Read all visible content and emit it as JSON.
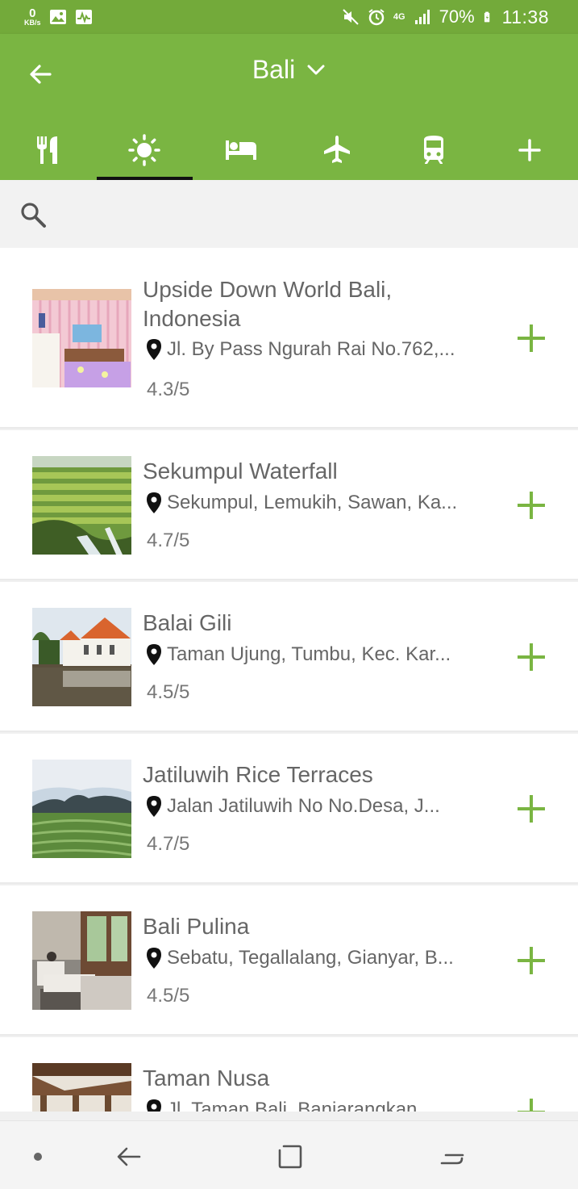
{
  "status_bar": {
    "speed_value": "0",
    "speed_unit": "KB/s",
    "network": "4G",
    "battery": "70%",
    "time": "11:38"
  },
  "header": {
    "title": "Bali",
    "tabs": [
      {
        "icon": "restaurant-icon",
        "active": false
      },
      {
        "icon": "sun-icon",
        "active": true
      },
      {
        "icon": "bed-icon",
        "active": false
      },
      {
        "icon": "airplane-icon",
        "active": false
      },
      {
        "icon": "train-icon",
        "active": false
      },
      {
        "icon": "plus-icon",
        "active": false
      }
    ]
  },
  "search": {
    "icon": "search-icon"
  },
  "places": [
    {
      "title": "Upside Down World Bali, Indonesia",
      "address": "Jl. By Pass Ngurah Rai No.762,...",
      "rating": "4.3/5"
    },
    {
      "title": "Sekumpul Waterfall",
      "address": "Sekumpul, Lemukih, Sawan, Ka...",
      "rating": "4.7/5"
    },
    {
      "title": "Balai Gili",
      "address": "Taman Ujung, Tumbu, Kec. Kar...",
      "rating": "4.5/5"
    },
    {
      "title": "Jatiluwih Rice Terraces",
      "address": "Jalan Jatiluwih No No.Desa, J...",
      "rating": "4.7/5"
    },
    {
      "title": "Bali Pulina",
      "address": "Sebatu, Tegallalang, Gianyar, B...",
      "rating": "4.5/5"
    },
    {
      "title": "Taman Nusa",
      "address": "Jl. Taman Bali, Banjarangkan,...",
      "rating": ""
    }
  ],
  "colors": {
    "app_bar": "#7ab542",
    "status_bar": "#73aa3a",
    "accent_add": "#7ab542",
    "text": "#666666"
  }
}
